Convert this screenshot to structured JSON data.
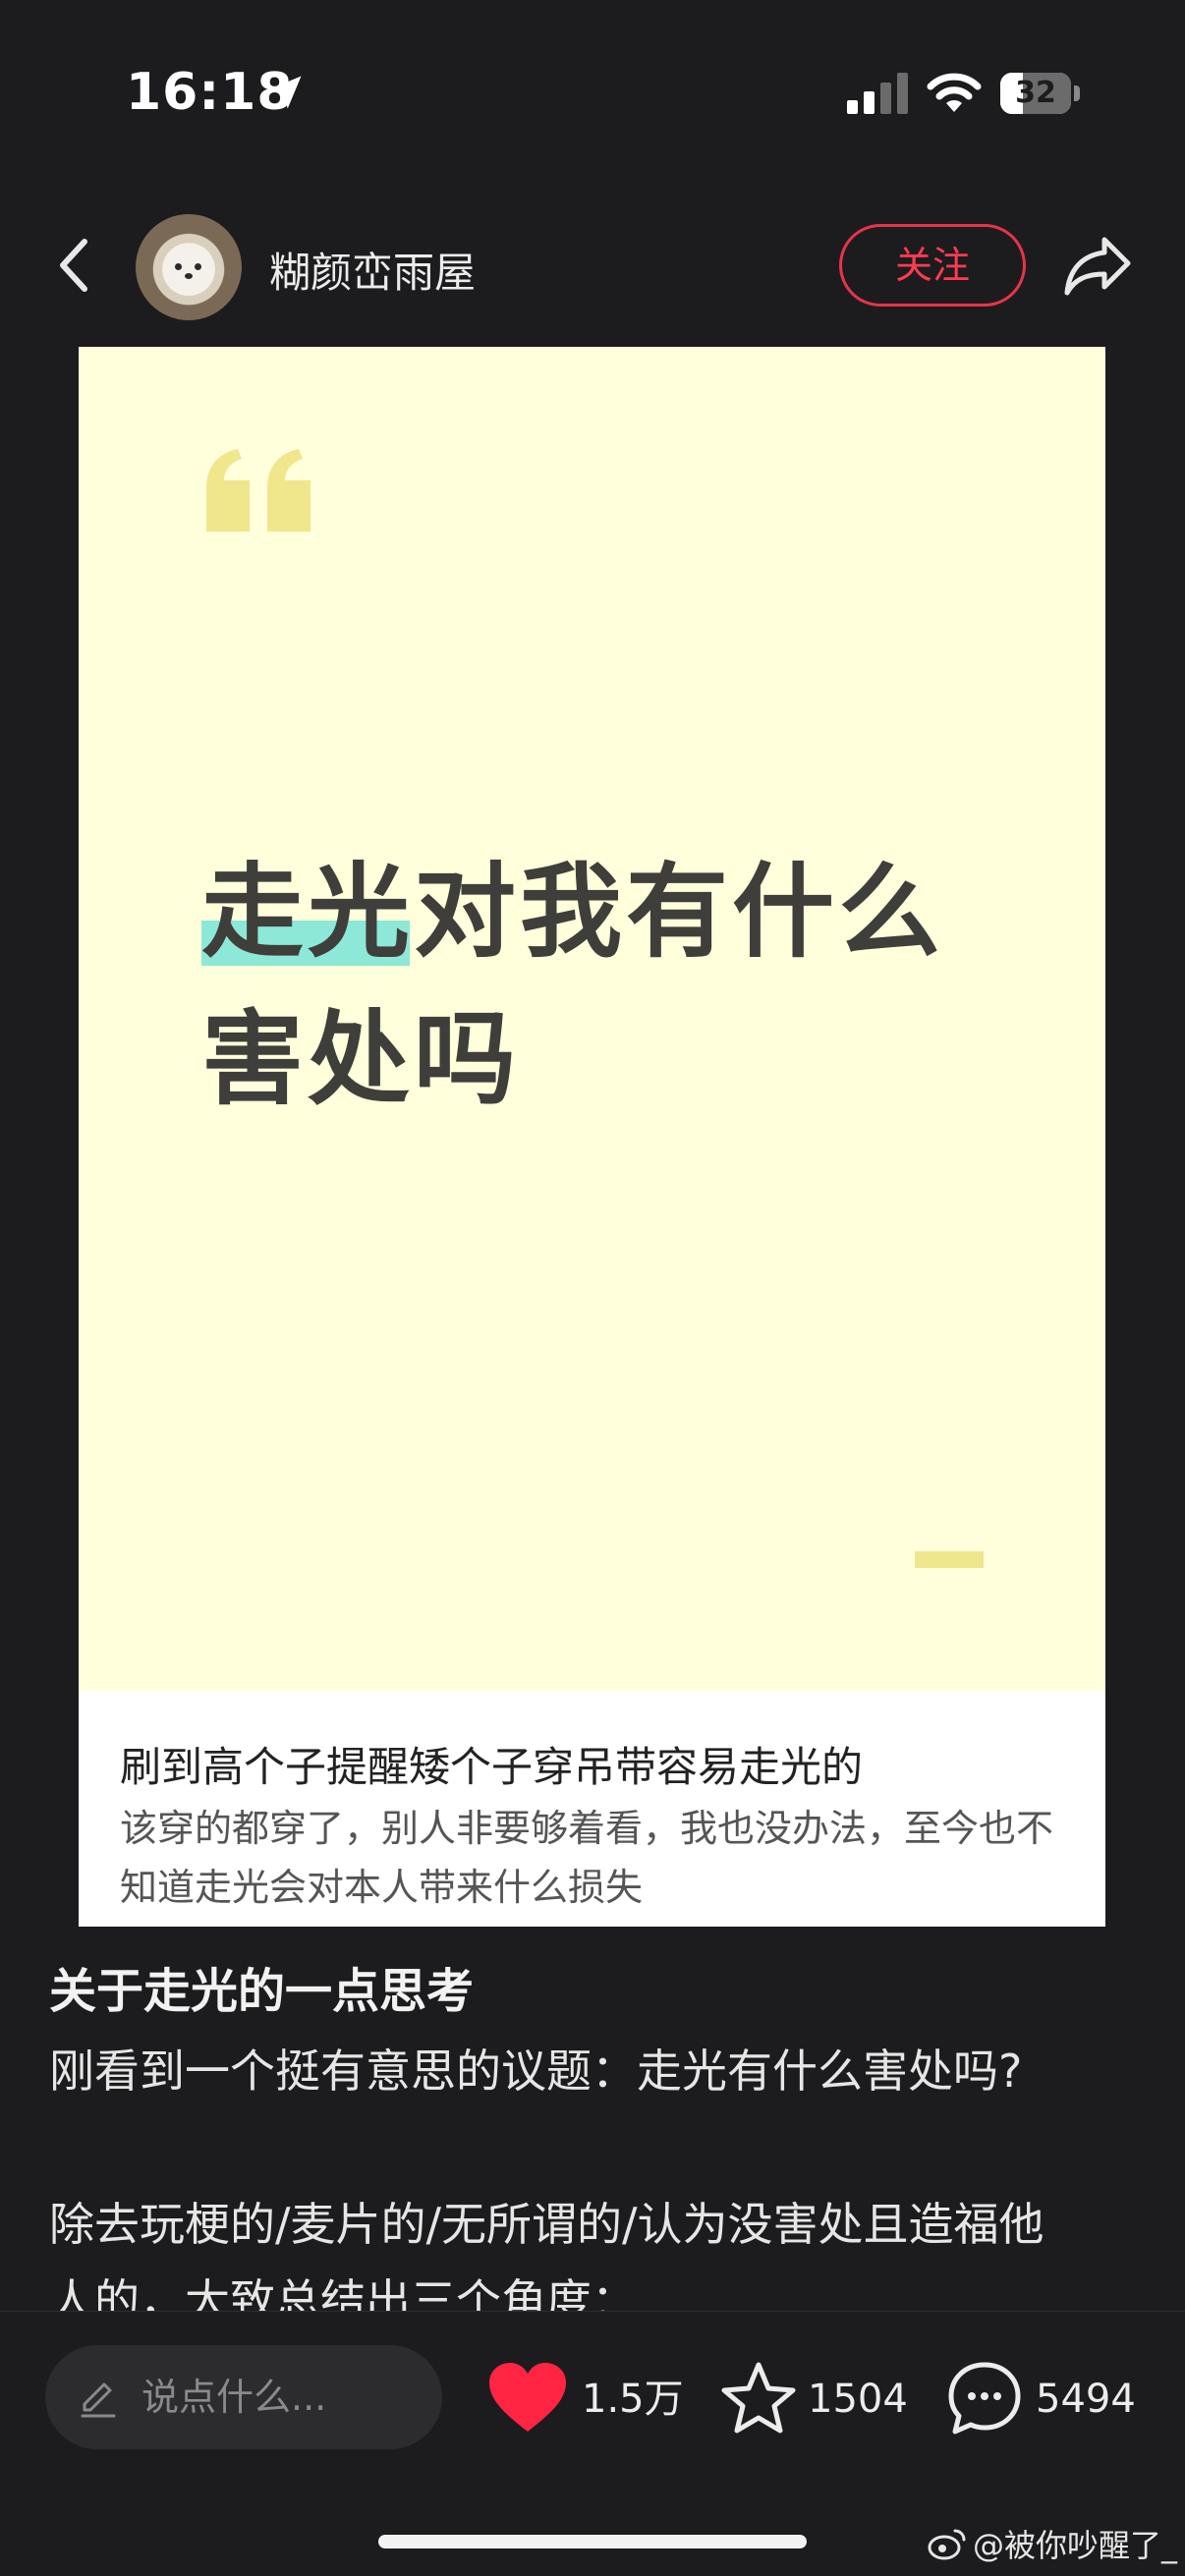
{
  "status_bar": {
    "time": "16:18",
    "battery": "32",
    "battery_level": 0.32,
    "icons": [
      "location-arrow-icon",
      "signal-icon",
      "wifi-icon",
      "battery-icon"
    ]
  },
  "header": {
    "username": "糊颜峦雨屋",
    "follow_label": "关注",
    "icons": [
      "back-icon",
      "share-icon"
    ]
  },
  "card": {
    "title_line1": "走光对我有什么",
    "title_line2": "害处吗",
    "heading": "刷到高个子提醒矮个子穿吊带容易走光的",
    "body": "该穿的都穿了，别人非要够着看，我也没办法，至今也不知道走光会对本人带来什么损失",
    "colors": {
      "background": "#ffffdc",
      "highlight": "#8de8d8",
      "quote": "#f0e68c"
    }
  },
  "post": {
    "title": "关于走光的一点思考",
    "line1": "刚看到一个挺有意思的议题：走光有什么害处吗?",
    "line2": "除去玩梗的/麦片的/无所谓的/认为没害处且造福他",
    "line3": "人的，大致总结出三个角度："
  },
  "bottom_bar": {
    "input_placeholder": "说点什么...",
    "likes": "1.5万",
    "favorites": "1504",
    "comments": "5494",
    "accent": "#ff2442"
  },
  "watermark": "@被你吵醒了_"
}
